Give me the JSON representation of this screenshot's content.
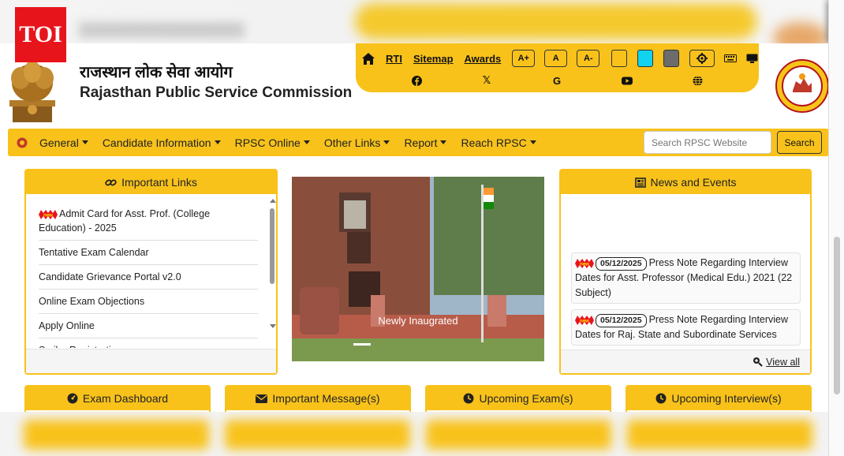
{
  "branding": {
    "toi_logo": "TOI"
  },
  "header": {
    "org_name_hindi": "राजस्थान लोक सेवा आयोग",
    "org_name_english": "Rajasthan Public Service Commission",
    "emblem_icon": "ashoka-emblem-icon",
    "seal_icon": "rpsc-seal-icon"
  },
  "toolbar": {
    "links": [
      "RTI",
      "Sitemap",
      "Awards"
    ],
    "font_buttons": [
      "A+",
      "A",
      "A-"
    ],
    "theme_colors": [
      "#f8c21b",
      "#12d3ef",
      "#6c6c6c"
    ],
    "social_icons": [
      "facebook-icon",
      "x-icon",
      "google-icon",
      "youtube-icon",
      "globe-icon"
    ],
    "google_glyph": "G",
    "x_glyph": "𝕏"
  },
  "nav": {
    "items": [
      "General",
      "Candidate Information",
      "RPSC Online",
      "Other Links",
      "Report",
      "Reach RPSC"
    ],
    "search_placeholder": "Search RPSC Website",
    "search_label": "Search"
  },
  "important_links": {
    "title": "Important Links",
    "items": [
      {
        "label": "Admit Card for Asst. Prof. (College Education) - 2025",
        "new": true
      },
      {
        "label": "Tentative Exam Calendar",
        "new": false
      },
      {
        "label": "Candidate Grievance Portal v2.0",
        "new": false
      },
      {
        "label": "Online Exam Objections",
        "new": false
      },
      {
        "label": "Apply Online",
        "new": false
      },
      {
        "label": "Scribe Registration",
        "new": false
      }
    ]
  },
  "photo": {
    "caption": "Newly Inaugrated"
  },
  "news": {
    "title": "News and Events",
    "items": [
      {
        "date": "05/12/2025",
        "text": "Press Note Regarding Interview Dates for Asst. Professor (Medical Edu.) 2021 (22 Subject)"
      },
      {
        "date": "05/12/2025",
        "text": "Press Note Regarding Interview Dates for Raj. State and Subordinate Services"
      }
    ],
    "view_all": "View all"
  },
  "cards": [
    "Exam Dashboard",
    "Important Message(s)",
    "Upcoming Exam(s)",
    "Upcoming Interview(s)"
  ]
}
